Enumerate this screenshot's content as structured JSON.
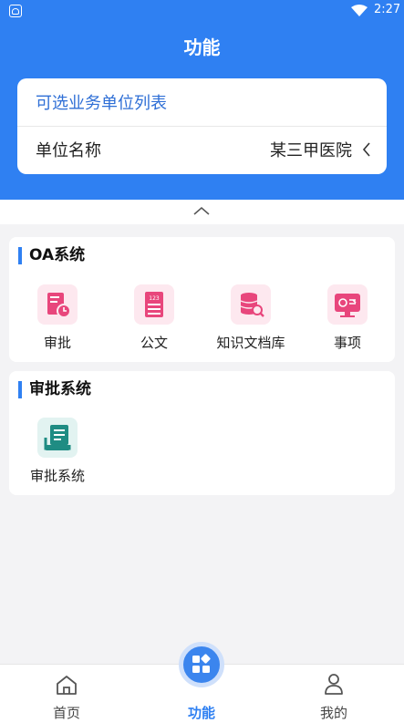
{
  "status": {
    "time": "2:27"
  },
  "header": {
    "title": "功能"
  },
  "unit_card": {
    "list_title": "可选业务单位列表",
    "name_label": "单位名称",
    "name_value": "某三甲医院"
  },
  "sections": [
    {
      "title": "OA系统",
      "items": [
        {
          "label": "审批",
          "icon": "approval-icon"
        },
        {
          "label": "公文",
          "icon": "document-icon"
        },
        {
          "label": "知识文档库",
          "icon": "knowledge-base-icon"
        },
        {
          "label": "事项",
          "icon": "matters-icon"
        }
      ]
    },
    {
      "title": "审批系统",
      "items": [
        {
          "label": "审批系统",
          "icon": "approval-system-icon"
        }
      ]
    }
  ],
  "tabbar": {
    "home": "首页",
    "functions": "功能",
    "mine": "我的"
  },
  "colors": {
    "primary": "#2f80f2",
    "pink_bg": "#fde8ef",
    "pink_icon": "#e8467c",
    "teal_bg": "#e2f3f1",
    "teal_icon": "#1f8c83"
  }
}
